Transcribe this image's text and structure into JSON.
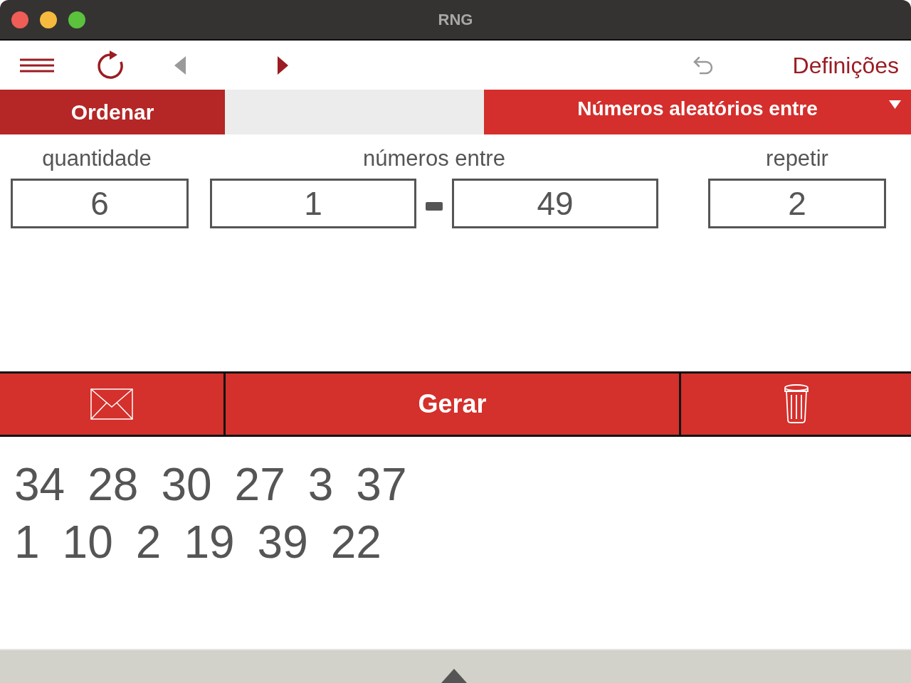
{
  "window": {
    "title": "RNG"
  },
  "toolbar": {
    "back": {
      "disabled": true
    },
    "forward": {
      "disabled": false
    },
    "undo": {
      "disabled": true
    },
    "settings": "Definições"
  },
  "mode_bar": {
    "sort": "Ordenar",
    "mode": "Números aleatórios entre"
  },
  "inputs": {
    "quantity": {
      "label": "quantidade",
      "value": "6"
    },
    "range": {
      "label": "números entre",
      "from": "1",
      "to": "49"
    },
    "repeat": {
      "label": "repetir",
      "value": "2"
    }
  },
  "actions": {
    "generate": "Gerar"
  },
  "results": [
    [
      "34",
      "28",
      "30",
      "27",
      "3",
      "37"
    ],
    [
      "1",
      "10",
      "2",
      "19",
      "39",
      "22"
    ]
  ]
}
